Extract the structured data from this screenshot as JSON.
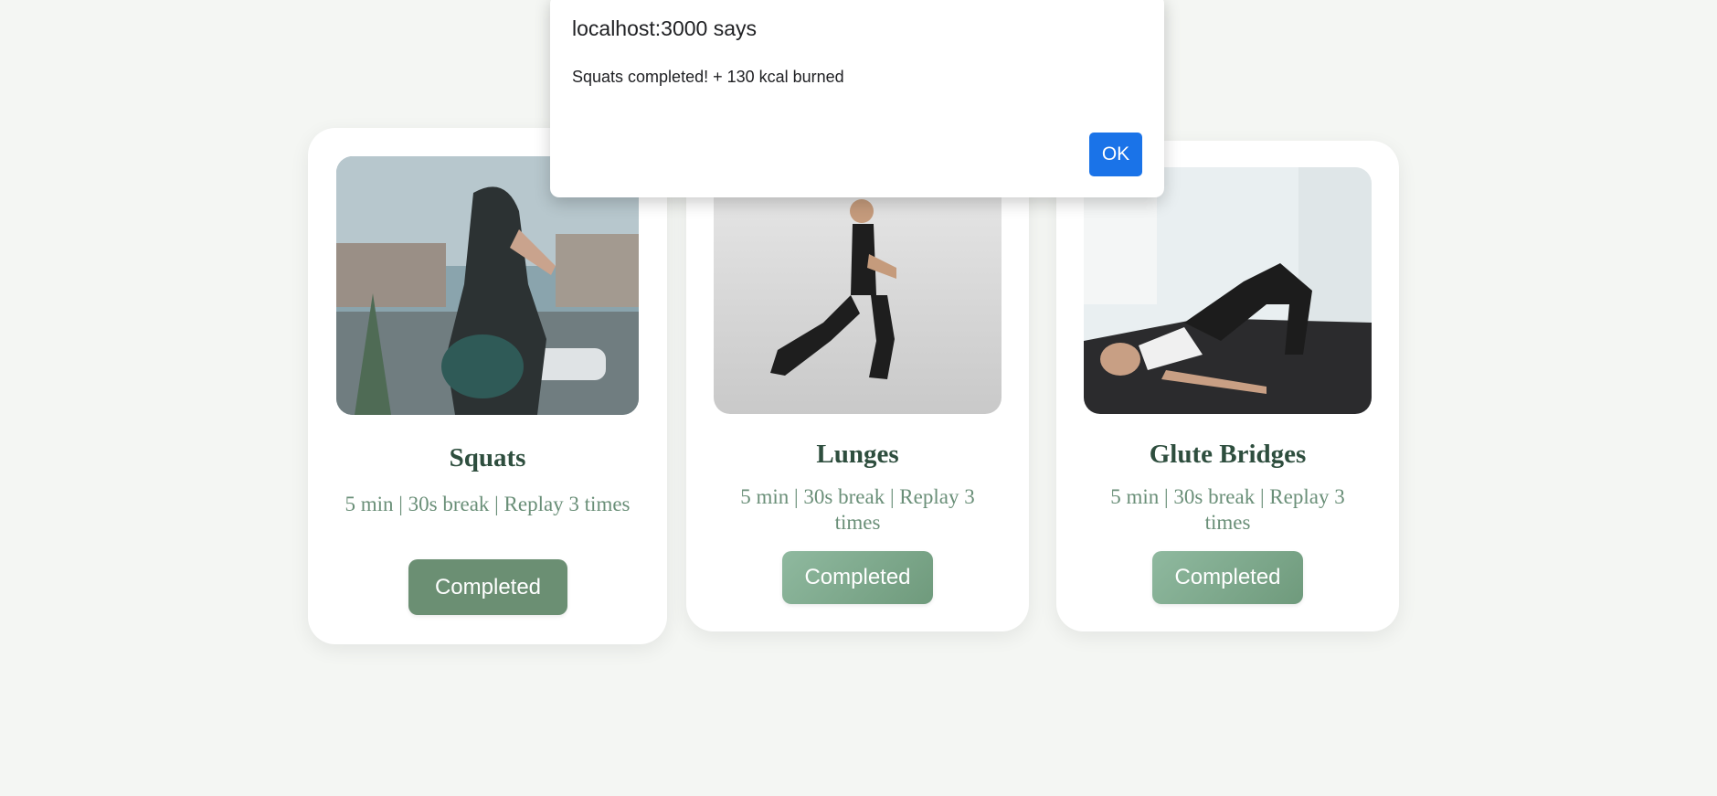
{
  "alert": {
    "title": "localhost:3000 says",
    "message": "Squats completed! + 130 kcal burned",
    "ok_label": "OK",
    "button_color": "#1a73e8"
  },
  "exercises": [
    {
      "name": "Squats",
      "details": "5 min | 30s break | Replay 3 times",
      "button_label": "Completed",
      "image_icon": "squat-exercise-photo"
    },
    {
      "name": "Lunges",
      "details": "5 min | 30s break | Replay 3 times",
      "button_label": "Completed",
      "image_icon": "lunge-exercise-photo"
    },
    {
      "name": "Glute Bridges",
      "details": "5 min | 30s break | Replay 3 times",
      "button_label": "Completed",
      "image_icon": "glute-bridge-exercise-photo"
    }
  ],
  "colors": {
    "page_background": "#f4f6f3",
    "title_color": "#2e4e3e",
    "meta_color": "#6a8f78",
    "completed_active": "#6b8f73",
    "completed_gradient_start": "#8fb99f",
    "completed_gradient_end": "#6f9a7c"
  }
}
